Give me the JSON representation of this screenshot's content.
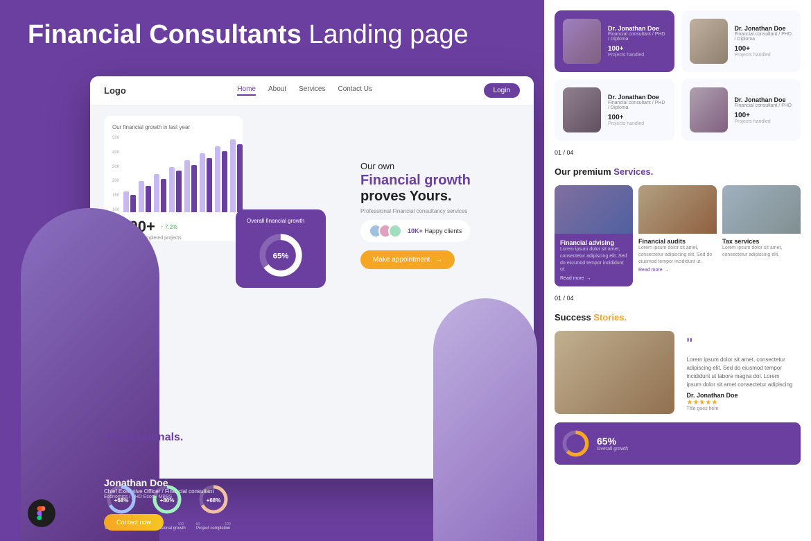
{
  "page": {
    "title": "Financial Consultants Landing page"
  },
  "left": {
    "main_title_bold": "Financial Consultants",
    "main_title_light": "Landing page",
    "browser": {
      "logo": "Logo",
      "nav": [
        "Home",
        "About",
        "Services",
        "Contact Us"
      ],
      "login": "Login",
      "chart_title": "Our financial growth in last year",
      "chart_y_labels": [
        "500",
        "400",
        "300",
        "200",
        "150",
        "100"
      ],
      "stat_number": "5000+",
      "stat_change": "↑ 7.2%",
      "stat_label": "Successfully completed projects",
      "growth_card_title": "Overall financial growth",
      "growth_percent": "65%",
      "hero_sub": "Our own",
      "hero_main_line1": "Financial growth",
      "hero_main_line2": "proves Yours.",
      "hero_tagline": "Professional Financial consultancy services",
      "clients_count": "10K+",
      "clients_label": "Happy clients",
      "appointment_btn": "Make appointment"
    },
    "person": {
      "name": "Jonathan Doe",
      "title": "Chief Executive Officer / Financial consultant",
      "creds": "Economics / PHD Econ / MBBS"
    },
    "gauges": [
      {
        "value": "+68%",
        "min": "00",
        "max": "100",
        "label": "Client satisfaction"
      },
      {
        "value": "+80%",
        "min": "00",
        "max": "100",
        "label": "Professional growth"
      },
      {
        "value": "+68%",
        "min": "00",
        "max": "100",
        "label": "Project completion"
      }
    ],
    "professionals_text": "Professionals.",
    "contact_btn": "Contact now",
    "figma_icon": "F"
  },
  "right": {
    "consultants": [
      {
        "name": "Dr. Jonathan Doe",
        "role": "Financial consultant / PHD / Diploma",
        "projects": "100+",
        "projects_label": "Projects handled",
        "card_type": "purple"
      },
      {
        "name": "Dr. Jonathan Doe",
        "role": "Financial consultant / PHD / Diploma",
        "projects": "100+",
        "projects_label": "Projects handled",
        "card_type": "light"
      },
      {
        "name": "Dr. Jonathan Doe",
        "role": "Financial consultant / PHD / Diploma",
        "projects": "100+",
        "projects_label": "Projects handled",
        "card_type": "light"
      },
      {
        "name": "Dr. Jonathan Doe",
        "role": "Financial consultant / PHD",
        "projects": "100+",
        "projects_label": "Projects handled",
        "card_type": "light"
      }
    ],
    "pagination": "01 / 04",
    "services_title_normal": "Our premium",
    "services_title_highlight": "Services.",
    "services": [
      {
        "name": "Financial advising",
        "desc": "Lorem ipsum dolor sit amet, consectetur adipiscing elit. Sed do eiusmod tempor incididunt ut."
      },
      {
        "name": "Financial audits",
        "desc": "Lorem ipsum dolor sit amet, consectetur adipiscing elit. Sed do eiusmod tempor incididunt ut."
      },
      {
        "name": "Tax services",
        "desc": "Lorem ipsum dolor sit amet, consectetur adipiscing elit."
      }
    ],
    "services_pagination": "01 / 04",
    "read_more": "Read more",
    "success_title_normal": "Success",
    "success_title_highlight": "Stories.",
    "quote_text": "Lorem ipsum dolor sit amet, consectetur adipiscing elit. Sed do eiusmod tempor incididunt ut labore magna dol. Lorem ipsum dolor sit amet consectetur adipiscing",
    "quote_author": "Dr. Jonathan Doe",
    "quote_author_title": "Title goes here",
    "mini_gauge_percent": "65%"
  }
}
